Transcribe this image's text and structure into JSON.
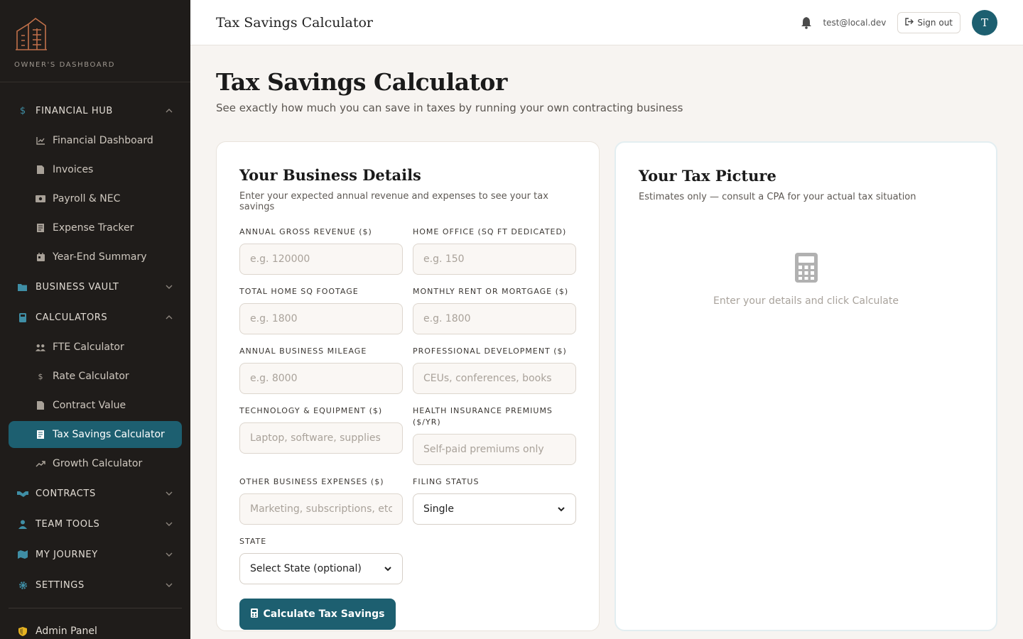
{
  "brand": {
    "label": "OWNER'S DASHBOARD",
    "logo_icon": "building-logo-icon"
  },
  "sidebar": {
    "sections": [
      {
        "label": "FINANCIAL HUB",
        "icon": "dollar-icon",
        "expanded": true,
        "items": [
          {
            "label": "Financial Dashboard",
            "icon": "chart-line-icon"
          },
          {
            "label": "Invoices",
            "icon": "file-icon"
          },
          {
            "label": "Payroll & NEC",
            "icon": "money-icon"
          },
          {
            "label": "Expense Tracker",
            "icon": "receipt-icon"
          },
          {
            "label": "Year-End Summary",
            "icon": "calendar-icon"
          }
        ]
      },
      {
        "label": "BUSINESS VAULT",
        "icon": "folder-icon",
        "expanded": false
      },
      {
        "label": "CALCULATORS",
        "icon": "calculator-icon",
        "expanded": true,
        "items": [
          {
            "label": "FTE Calculator",
            "icon": "users-icon"
          },
          {
            "label": "Rate Calculator",
            "icon": "dollar-icon"
          },
          {
            "label": "Contract Value",
            "icon": "file-icon"
          },
          {
            "label": "Tax Savings Calculator",
            "icon": "file-icon",
            "active": true
          },
          {
            "label": "Growth Calculator",
            "icon": "trend-up-icon"
          }
        ]
      },
      {
        "label": "CONTRACTS",
        "icon": "handshake-icon",
        "expanded": false
      },
      {
        "label": "TEAM TOOLS",
        "icon": "user-icon",
        "expanded": false
      },
      {
        "label": "MY JOURNEY",
        "icon": "map-icon",
        "expanded": false
      },
      {
        "label": "SETTINGS",
        "icon": "gear-icon",
        "expanded": false
      }
    ],
    "admin": {
      "label": "Admin Panel",
      "icon": "shield-icon"
    }
  },
  "topbar": {
    "title": "Tax Savings Calculator",
    "email": "test@local.dev",
    "signout": "Sign out",
    "avatar_initial": "T"
  },
  "page": {
    "title": "Tax Savings Calculator",
    "subtitle": "See exactly how much you can save in taxes by running your own contracting business"
  },
  "form": {
    "title": "Your Business Details",
    "subtitle": "Enter your expected annual revenue and expenses to see your tax savings",
    "fields": {
      "revenue": {
        "label": "ANNUAL GROSS REVENUE ($)",
        "placeholder": "e.g. 120000",
        "value": ""
      },
      "home_office": {
        "label": "HOME OFFICE (SQ FT DEDICATED)",
        "placeholder": "e.g. 150",
        "value": ""
      },
      "home_sqft": {
        "label": "TOTAL HOME SQ FOOTAGE",
        "placeholder": "e.g. 1800",
        "value": ""
      },
      "rent": {
        "label": "MONTHLY RENT OR MORTGAGE ($)",
        "placeholder": "e.g. 1800",
        "value": ""
      },
      "mileage": {
        "label": "ANNUAL BUSINESS MILEAGE",
        "placeholder": "e.g. 8000",
        "value": ""
      },
      "prof_dev": {
        "label": "PROFESSIONAL DEVELOPMENT ($)",
        "placeholder": "CEUs, conferences, books",
        "value": ""
      },
      "tech": {
        "label": "TECHNOLOGY & EQUIPMENT ($)",
        "placeholder": "Laptop, software, supplies",
        "value": ""
      },
      "health": {
        "label": "HEALTH INSURANCE PREMIUMS ($/YR)",
        "placeholder": "Self-paid premiums only",
        "value": ""
      },
      "other": {
        "label": "OTHER BUSINESS EXPENSES ($)",
        "placeholder": "Marketing, subscriptions, etc",
        "value": ""
      },
      "filing": {
        "label": "FILING STATUS",
        "selected": "Single"
      },
      "state": {
        "label": "STATE",
        "selected": "Select State (optional)"
      }
    },
    "submit": "Calculate Tax Savings"
  },
  "results": {
    "title": "Your Tax Picture",
    "subtitle": "Estimates only — consult a CPA for your actual tax situation",
    "empty_text": "Enter your details and click Calculate",
    "empty_icon": "calculator-icon"
  },
  "colors": {
    "accent": "#1d5f70",
    "sidebar_bg": "#1f1c1a",
    "page_bg": "#f7f4f1",
    "brand": "#c0704a",
    "admin_icon": "#e7b321"
  }
}
